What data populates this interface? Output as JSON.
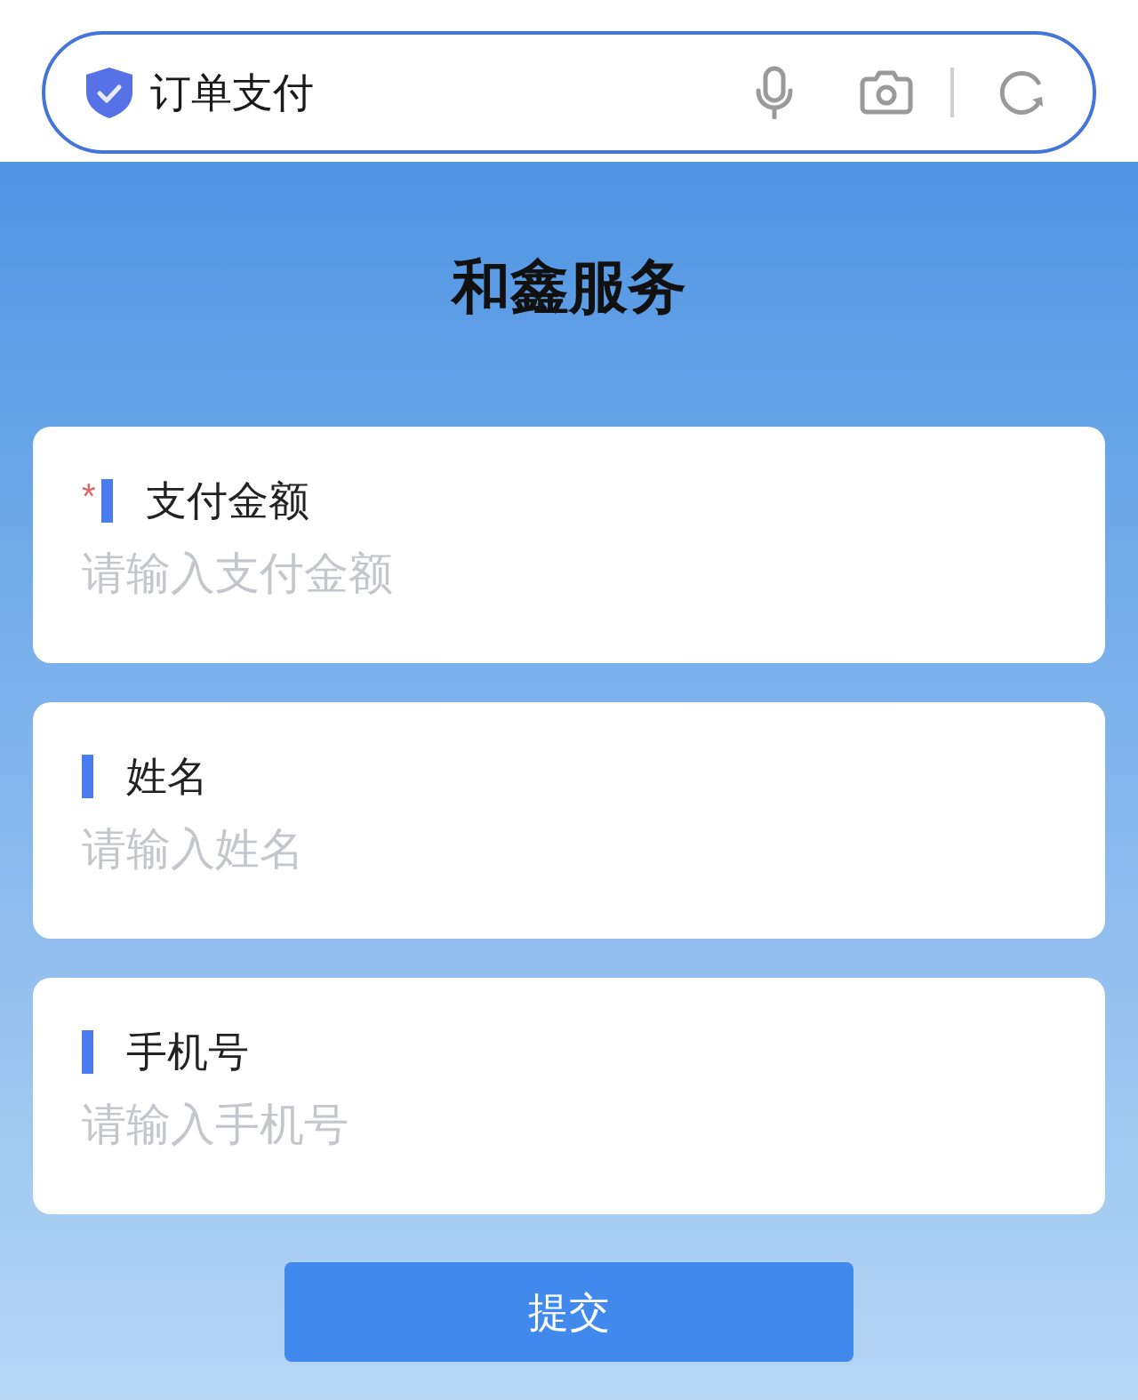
{
  "address_bar": {
    "title": "订单支付"
  },
  "header": {
    "title": "和鑫服务"
  },
  "fields": [
    {
      "label": "支付金额",
      "placeholder": "请输入支付金额",
      "required_mark": "*"
    },
    {
      "label": "姓名",
      "placeholder": "请输入姓名"
    },
    {
      "label": "手机号",
      "placeholder": "请输入手机号"
    }
  ],
  "submit_button": "提交"
}
